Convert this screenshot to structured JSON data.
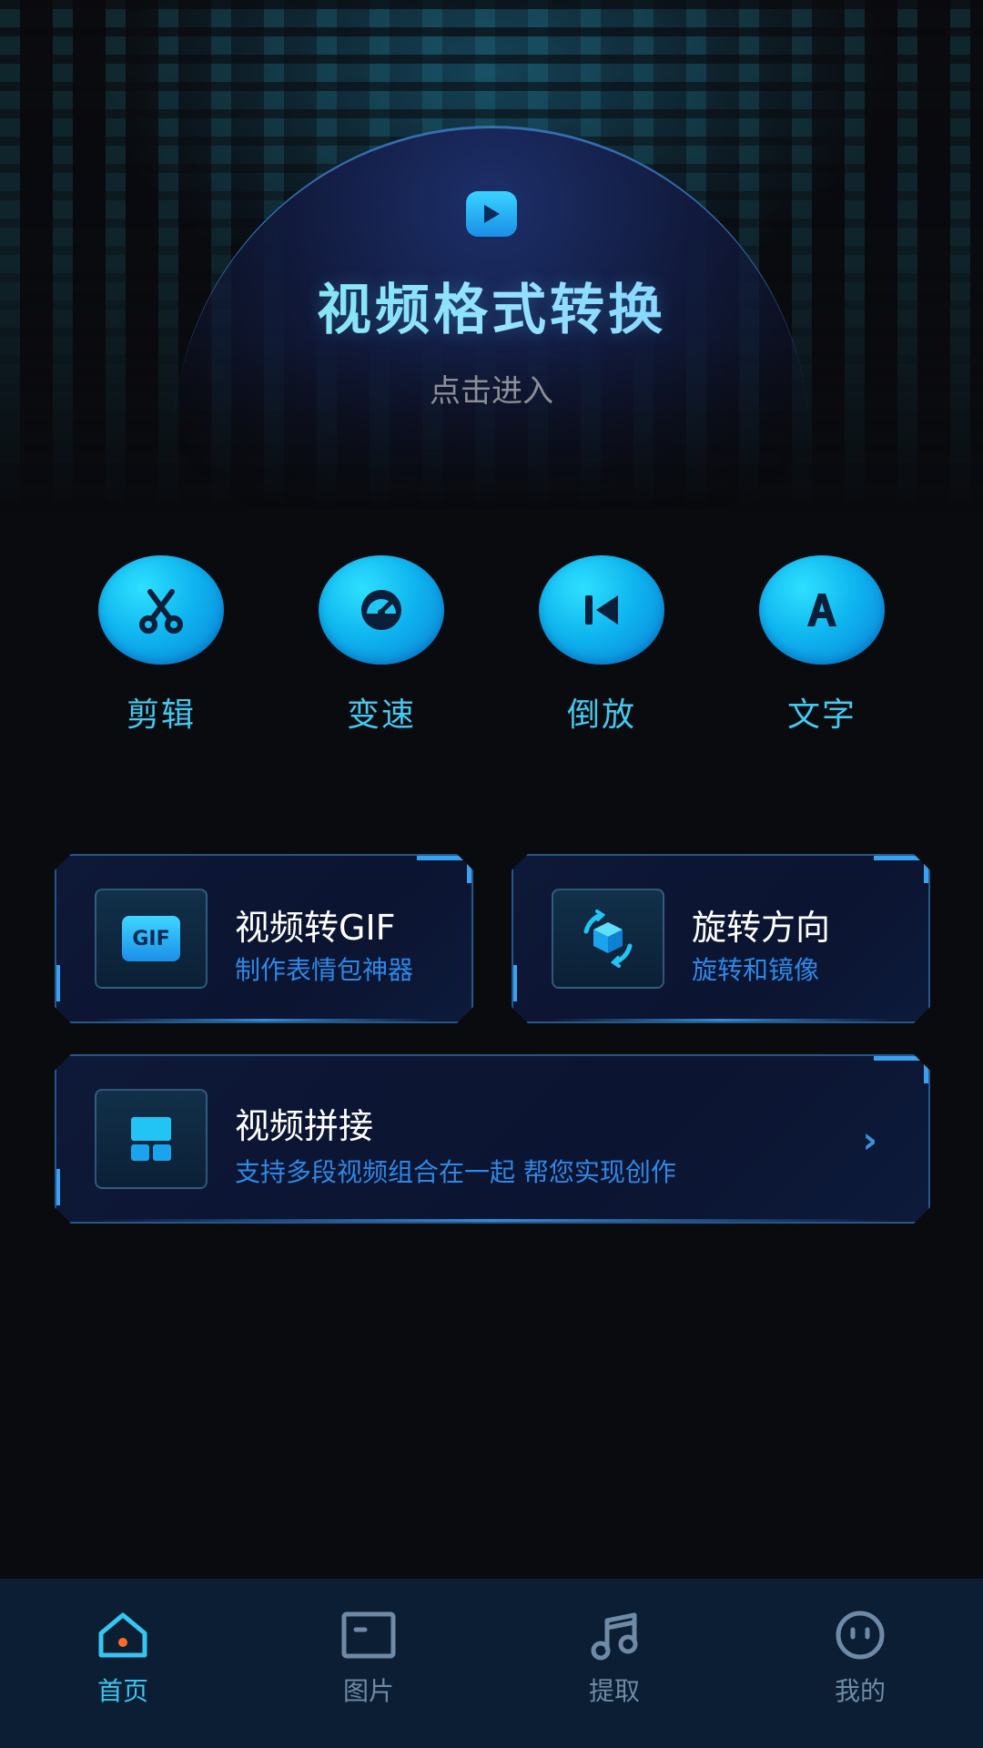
{
  "hero": {
    "title": "视频格式转换",
    "subtitle": "点击进入",
    "icon": "play-icon"
  },
  "tools": [
    {
      "label": "剪辑",
      "icon": "scissors-icon"
    },
    {
      "label": "变速",
      "icon": "speedometer-icon"
    },
    {
      "label": "倒放",
      "icon": "rewind-icon"
    },
    {
      "label": "文字",
      "icon": "text-icon"
    }
  ],
  "cards": {
    "gif": {
      "title": "视频转GIF",
      "subtitle": "制作表情包神器",
      "icon_text": "GIF",
      "icon": "gif-icon"
    },
    "rotate": {
      "title": "旋转方向",
      "subtitle": "旋转和镜像",
      "icon": "rotate-cube-icon"
    },
    "splice": {
      "title": "视频拼接",
      "subtitle": "支持多段视频组合在一起 帮您实现创作",
      "icon": "grid-icon"
    }
  },
  "nav": [
    {
      "label": "首页",
      "icon": "home-icon",
      "active": true
    },
    {
      "label": "图片",
      "icon": "image-icon",
      "active": false
    },
    {
      "label": "提取",
      "icon": "music-icon",
      "active": false
    },
    {
      "label": "我的",
      "icon": "profile-icon",
      "active": false
    }
  ],
  "colors": {
    "accent": "#37c6f0",
    "card_border": "#3aa0f0",
    "subtitle_blue": "#2f88e6",
    "background": "#0a0b0f",
    "nav_bg": "#0b1e33",
    "home_dot": "#ff6a2a"
  }
}
